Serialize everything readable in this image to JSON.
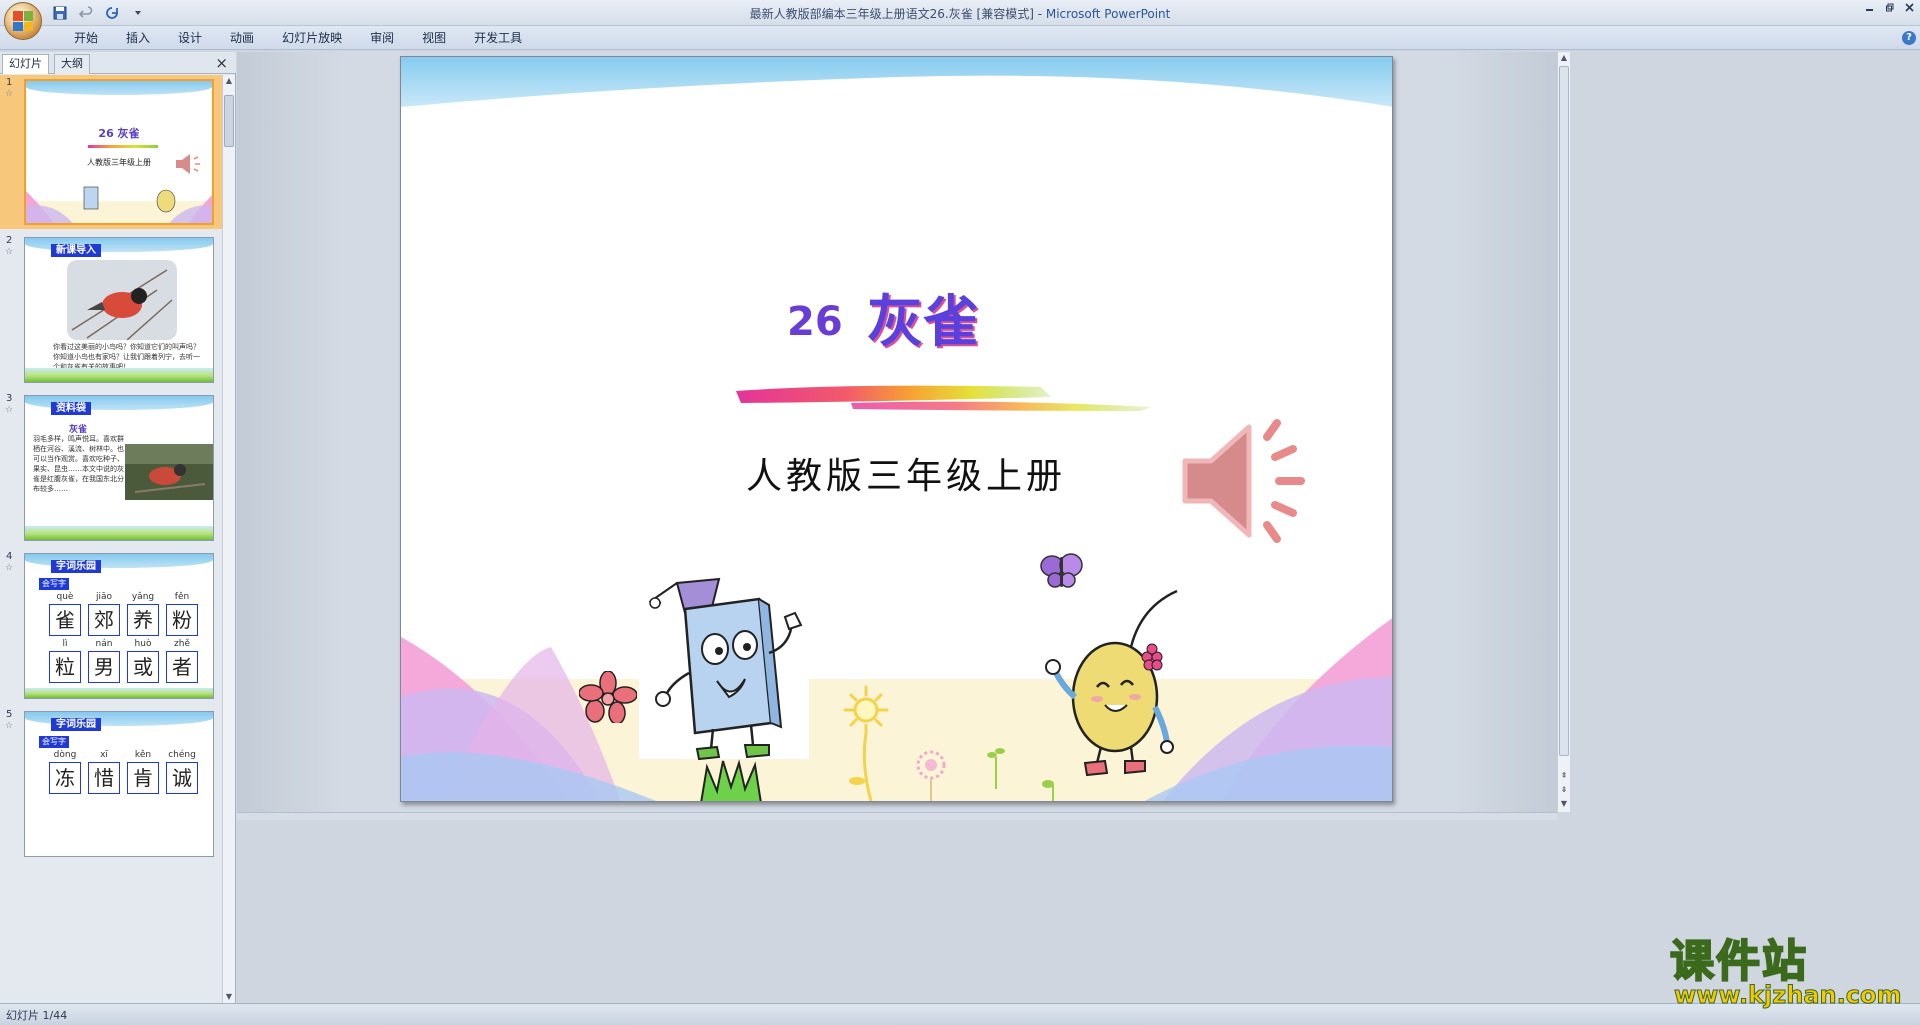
{
  "window": {
    "title_doc": "最新人教版部编本三年级上册语文26.灰雀 [兼容模式] - ",
    "title_app": "Microsoft PowerPoint"
  },
  "ribbon": {
    "tabs": [
      "开始",
      "插入",
      "设计",
      "动画",
      "幻灯片放映",
      "审阅",
      "视图",
      "开发工具"
    ]
  },
  "left_panel": {
    "tab_slides": "幻灯片",
    "tab_outline": "大纲",
    "close_symbol": "×"
  },
  "thumbnails": {
    "s1": {
      "num": "1",
      "title": "26 灰雀",
      "subtitle": "人教版三年级上册"
    },
    "s2": {
      "num": "2",
      "header": "新课导入",
      "text": "你看过这美丽的小鸟吗？你知道它们的叫声吗？你知道小鸟也有家吗？让我们跟着列宁，去听一个和灰雀有关的故事吧！"
    },
    "s3": {
      "num": "3",
      "header": "资料袋",
      "subhead": "灰雀",
      "text": "羽毛多样，鸣声悦耳。喜欢群栖在河谷、溪流、树林中。也可以当作观赏。喜欢吃种子、果实、昆虫……本文中说的灰雀是红腹灰雀，在我国东北分布较多……"
    },
    "s4": {
      "num": "4",
      "header": "字词乐园",
      "badge": "会写字",
      "pinyin_row1": [
        "què",
        "jiāo",
        "yǎng",
        "fěn"
      ],
      "chars_row1": [
        "雀",
        "郊",
        "养",
        "粉"
      ],
      "pinyin_row2": [
        "lì",
        "nán",
        "huò",
        "zhě"
      ],
      "chars_row2": [
        "粒",
        "男",
        "或",
        "者"
      ]
    },
    "s5": {
      "num": "5",
      "header": "字词乐园",
      "badge": "会写字",
      "pinyin_row1": [
        "dòng",
        "xī",
        "kěn",
        "chéng"
      ],
      "chars_row1": [
        "冻",
        "惜",
        "肯",
        "诚"
      ]
    }
  },
  "slide": {
    "number": "26",
    "title": "灰雀",
    "subtitle": "人教版三年级上册",
    "icons": [
      "speaker-icon",
      "butterfly-icon",
      "flower-icon",
      "book-character",
      "egg-character"
    ]
  },
  "status": {
    "slide_info": "幻灯片 1/44"
  },
  "watermark": {
    "cn": "课件站",
    "url": "www.kjzhan.com"
  },
  "colors": {
    "accent_blue": "#1f3ad6",
    "selected_thumb": "#f7c77b",
    "speaker": "#e98a8a"
  }
}
